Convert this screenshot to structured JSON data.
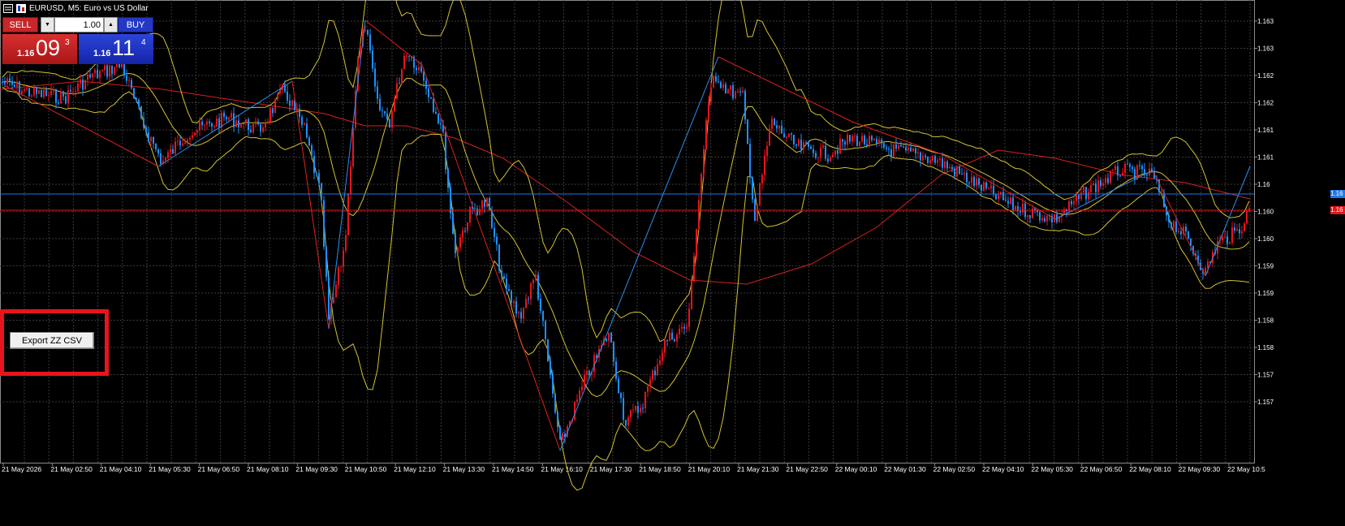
{
  "title": "EURUSD, M5:  Euro vs US Dollar",
  "trade_panel": {
    "sell_label": "SELL",
    "buy_label": "BUY",
    "lot_value": "1.00",
    "bid": {
      "small": "1.16",
      "big": "09",
      "sup": "3"
    },
    "ask": {
      "small": "1.16",
      "big": "11",
      "sup": "4"
    }
  },
  "export_button": {
    "label": "Export ZZ CSV"
  },
  "price_axis": {
    "labels": [
      "1.163",
      "1.163",
      "1.162",
      "1.162",
      "1.161",
      "1.161",
      "1.16",
      "1.160",
      "1.160",
      "1.159",
      "1.159",
      "1.158",
      "1.158",
      "1.157",
      "1.157"
    ],
    "ask_tag": "1.16",
    "bid_tag": "1.16"
  },
  "time_axis": {
    "labels": [
      "21 May 2026",
      "21 May 02:50",
      "21 May 04:10",
      "21 May 05:30",
      "21 May 06:50",
      "21 May 08:10",
      "21 May 09:30",
      "21 May 10:50",
      "21 May 12:10",
      "21 May 13:30",
      "21 May 14:50",
      "21 May 16:10",
      "21 May 17:30",
      "21 May 18:50",
      "21 May 20:10",
      "21 May 21:30",
      "21 May 22:50",
      "22 May 00:10",
      "22 May 01:30",
      "22 May 02:50",
      "22 May 04:10",
      "22 May 05:30",
      "22 May 06:50",
      "22 May 08:10",
      "22 May 09:30",
      "22 May 10:5"
    ]
  },
  "colors": {
    "background": "#000000",
    "grid": "#3a3a3a",
    "bull_candle": "#e8141c",
    "bear_candle": "#1e90ff",
    "bollinger": "#d4c230",
    "moving_average": "#d42020",
    "zigzag_red": "#e02020",
    "zigzag_blue": "#2a8ff0",
    "ask_line": "#1e78e8",
    "bid_line": "#e81414",
    "highlight": "#e8141c"
  }
}
